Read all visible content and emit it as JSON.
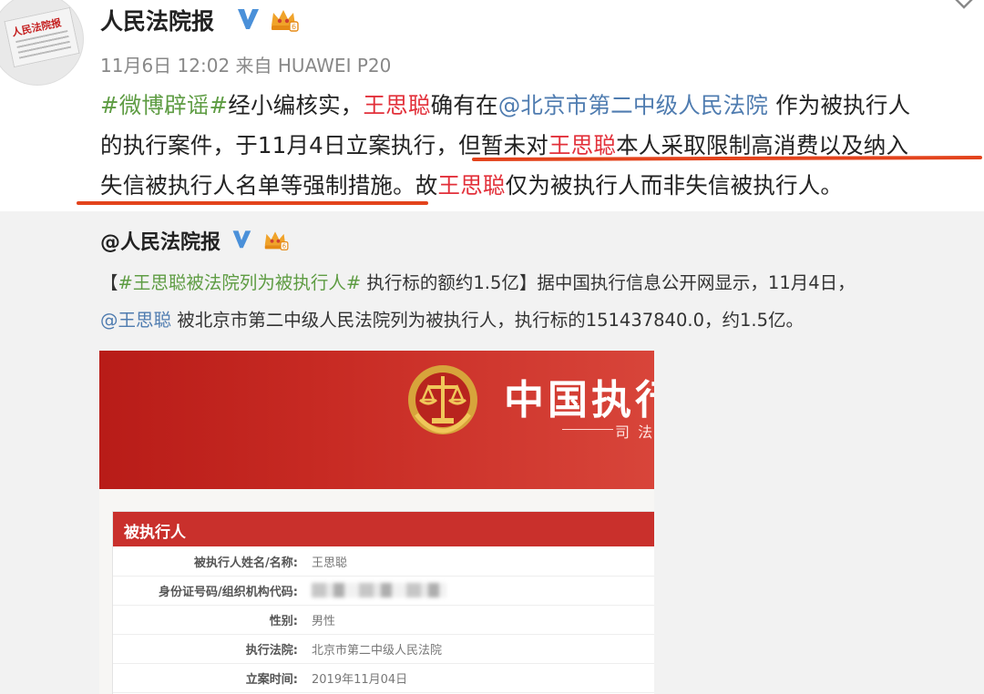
{
  "post": {
    "account_name": "人民法院报",
    "avatar_text": "人民法院报",
    "timestamp": "11月6日 12:02",
    "source_prefix": "来自",
    "device": "HUAWEI P20",
    "line1": {
      "hashtag": "#微博辟谣#",
      "t1": "经小编核实，",
      "person": "王思聪",
      "t2": "确有在",
      "mention": "@北京市第二中级人民法院",
      "t3": " 作为被执行人"
    },
    "line2": {
      "t1": "的执行案件，于11月4日立案执行，",
      "t2": "但暂未对",
      "person": "王思聪",
      "t3": "本人采取限制高消费以及纳入"
    },
    "line3": {
      "t1": "失信被执行人名单等强制措施",
      "t2": "。故",
      "person": "王思聪",
      "t3": "仅为被执行人而非失信被执行人。"
    }
  },
  "repost": {
    "account_mention": "@人民法院报",
    "line1": {
      "bracket_open": "【",
      "hashtag": "#王思聪被法院列为被执行人#",
      "t1": " 执行标的额约1.5亿】据中国执行信息公开网显示，11月4日，"
    },
    "line2": {
      "mention": "@王思聪",
      "t1": " 被北京市第二中级人民法院列为被执行人，执行标的151437840.0，约1.5亿。"
    }
  },
  "screenshot": {
    "banner_title": "中国执行",
    "banner_sub": "司 法",
    "section_title": "被执行人",
    "rows": [
      {
        "label": "被执行人姓名/名称:",
        "value": "王思聪"
      },
      {
        "label": "身份证号码/组织机构代码:",
        "value": ""
      },
      {
        "label": "性别:",
        "value": "男性"
      },
      {
        "label": "执行法院:",
        "value": "北京市第二中级人民法院"
      },
      {
        "label": "立案时间:",
        "value": "2019年11月04日"
      }
    ]
  },
  "colors": {
    "hashtag_green": "#5e9c43",
    "name_red": "#e2303a",
    "mention_blue": "#4f7cb0",
    "underline_orange": "#e3431c",
    "banner_red": "#c72a23"
  },
  "icons": [
    "verified-badge-icon",
    "vip-crown-icon",
    "chevron-down-icon",
    "court-emblem-icon"
  ]
}
